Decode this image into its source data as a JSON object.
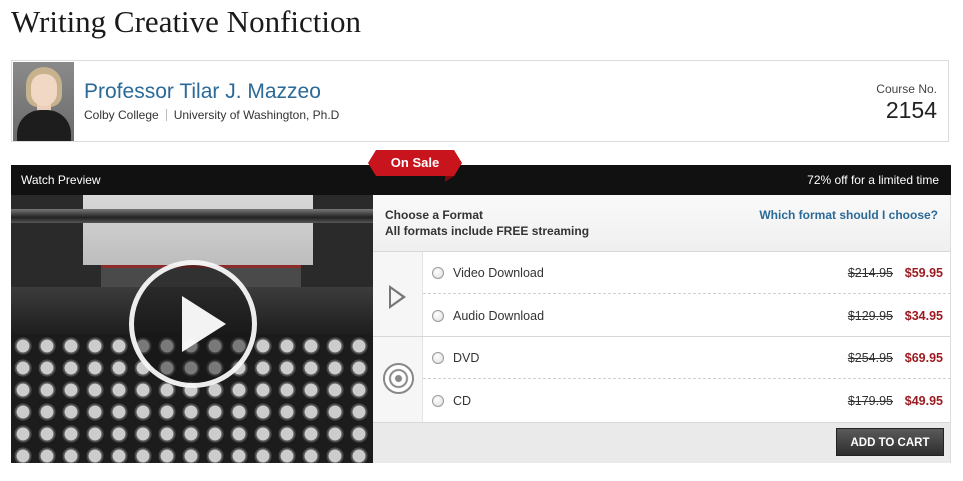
{
  "page": {
    "title": "Writing Creative Nonfiction"
  },
  "professor": {
    "name": "Professor Tilar J. Mazzeo",
    "affiliations": [
      "Colby College",
      "University of Washington, Ph.D"
    ],
    "course_label": "Course No.",
    "course_number": "2154"
  },
  "banner": {
    "watch_preview": "Watch Preview",
    "sale_badge": "On Sale",
    "discount": "72% off for a limited time"
  },
  "format": {
    "title": "Choose a Format",
    "subtitle": "All formats include FREE streaming",
    "help_link": "Which format should I choose?",
    "options": [
      {
        "label": "Video Download",
        "old_price": "$214.95",
        "price": "$59.95",
        "selected": false
      },
      {
        "label": "Audio Download",
        "old_price": "$129.95",
        "price": "$34.95",
        "selected": false
      },
      {
        "label": "DVD",
        "old_price": "$254.95",
        "price": "$69.95",
        "selected": false
      },
      {
        "label": "CD",
        "old_price": "$179.95",
        "price": "$49.95",
        "selected": false
      }
    ],
    "add_to_cart": "ADD TO CART"
  },
  "icons": {
    "digital": "play-outline-icon",
    "physical": "disc-icon",
    "preview": "play-circle-icon"
  },
  "colors": {
    "accent_blue": "#2b6a97",
    "sale_red": "#c8141c",
    "price_red": "#9c1a1f",
    "bar": "#111111"
  }
}
